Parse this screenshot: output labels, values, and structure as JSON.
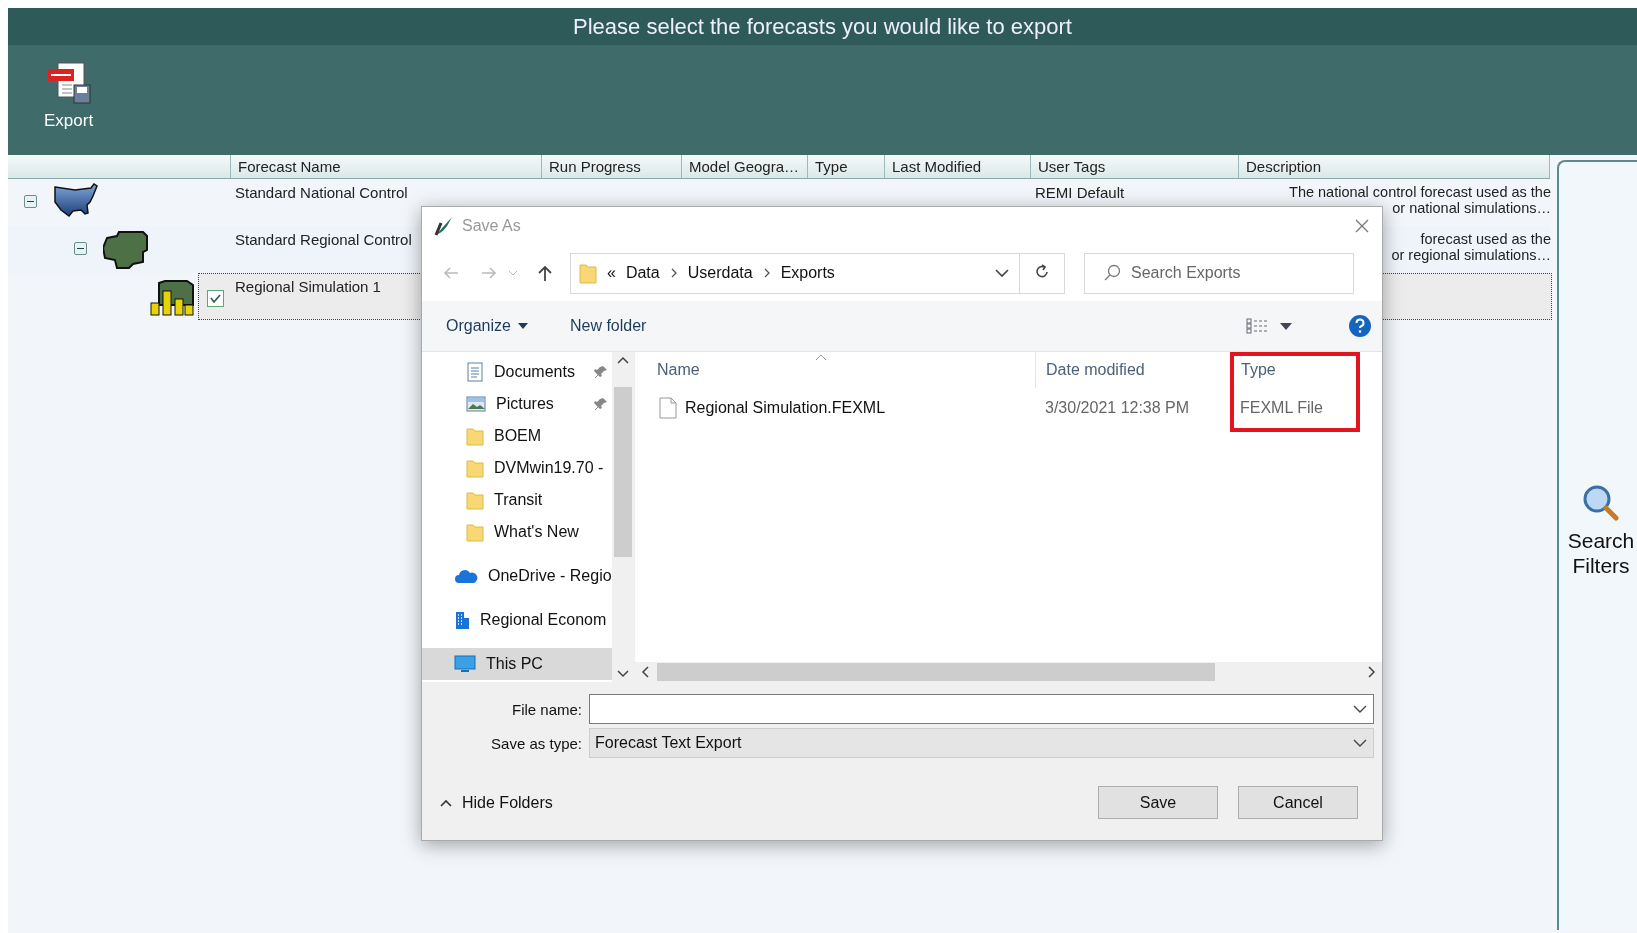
{
  "title": "Please select the forecasts you would like to export",
  "toolbar": [
    {
      "label": "Export",
      "kind": "export"
    }
  ],
  "grid": {
    "columns": [
      "Forecast Name",
      "Run Progress",
      "Model Geogra…",
      "Type",
      "Last Modified",
      "User Tags",
      "Description"
    ],
    "rows": [
      {
        "name": "Standard National Control",
        "kind": "nation",
        "expanded": true,
        "user_tags": "REMI Default",
        "description": [
          "The national control forecast used as the",
          "or national simulations…"
        ],
        "children": [
          {
            "name": "Standard Regional Control",
            "kind": "region",
            "expanded": true,
            "description": [
              "forecast used as the",
              "or regional simulations…"
            ],
            "children": [
              {
                "name": "Regional Simulation 1",
                "kind": "simulation",
                "checked": true,
                "selected": true
              }
            ]
          }
        ]
      }
    ]
  },
  "side": {
    "label": "Search Filters"
  },
  "dialog": {
    "title": "Save As",
    "overflow": "«",
    "path": [
      "Data",
      "Userdata",
      "Exports"
    ],
    "search": {
      "placeholder": "Search Exports"
    },
    "commands": [
      {
        "label": "Organize",
        "kind": "menu"
      },
      {
        "label": "New folder",
        "kind": "plain"
      }
    ],
    "nav": [
      {
        "label": "Documents",
        "kind": "documents",
        "pinned": true,
        "selected": false
      },
      {
        "label": "Pictures",
        "kind": "pictures",
        "pinned": true,
        "selected": false
      },
      {
        "label": "BOEM",
        "kind": "folder",
        "pinned": false,
        "selected": false
      },
      {
        "label": "DVMwin19.70 -",
        "kind": "folder",
        "pinned": false,
        "selected": false
      },
      {
        "label": "Transit",
        "kind": "folder",
        "pinned": false,
        "selected": false
      },
      {
        "label": "What's New",
        "kind": "folder",
        "pinned": false,
        "selected": false
      },
      {
        "label": "OneDrive - Regio",
        "kind": "cloud",
        "pinned": false,
        "selected": false
      },
      {
        "label": "Regional Econom",
        "kind": "building",
        "pinned": false,
        "selected": false
      },
      {
        "label": "This PC",
        "kind": "pc",
        "pinned": false,
        "selected": true
      }
    ],
    "columns": [
      {
        "label": "Name",
        "highlighted": false
      },
      {
        "label": "Date modified",
        "highlighted": false
      },
      {
        "label": "Type",
        "highlighted": true
      }
    ],
    "files": [
      {
        "name": "Regional Simulation.FEXML",
        "date": "3/30/2021 12:38 PM",
        "type": "FEXML File"
      }
    ],
    "file_name": {
      "label": "File name:"
    },
    "save_type": {
      "label": "Save as type:",
      "value": "Forecast Text Export"
    },
    "hide_folders": "Hide Folders",
    "buttons": [
      "Save",
      "Cancel"
    ]
  }
}
